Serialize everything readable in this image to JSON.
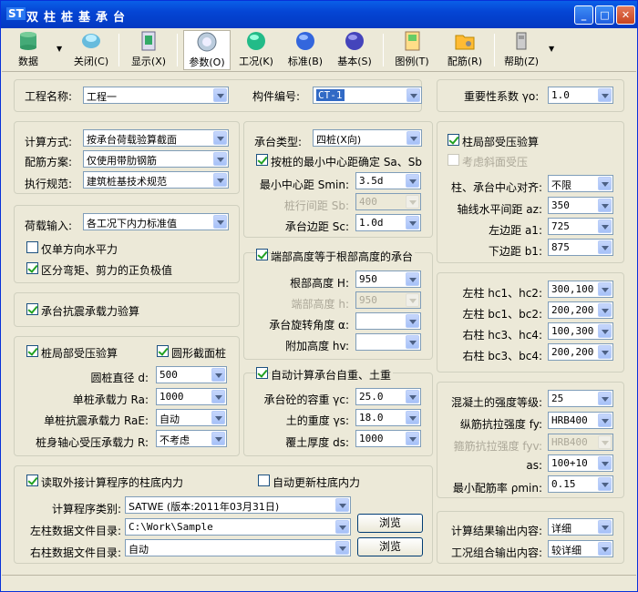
{
  "app": {
    "logo": "ST",
    "title": "双柱桩基承台"
  },
  "toolbar": [
    {
      "name": "data",
      "label": "数据",
      "icon": "database-icon",
      "color": "#3b6"
    },
    {
      "name": "close",
      "label": "关闭(C)",
      "icon": "close-doc-icon",
      "color": "#39c"
    },
    {
      "name": "show",
      "label": "显示(X)",
      "icon": "display-icon",
      "color": "#396"
    },
    {
      "name": "params",
      "label": "参数(O)",
      "icon": "params-icon",
      "color": "#8ad"
    },
    {
      "name": "condition",
      "label": "工况(K)",
      "icon": "green-ball-icon",
      "color": "#3c9"
    },
    {
      "name": "standard",
      "label": "标准(B)",
      "icon": "blue-ball-icon",
      "color": "#36d"
    },
    {
      "name": "basic",
      "label": "基本(S)",
      "icon": "purple-ball-icon",
      "color": "#55c"
    },
    {
      "name": "drawing",
      "label": "图例(T)",
      "icon": "drawing-icon",
      "color": "#c93"
    },
    {
      "name": "rebar",
      "label": "配筋(R)",
      "icon": "rebar-folder-icon",
      "color": "#e90"
    },
    {
      "name": "help",
      "label": "帮助(Z)",
      "icon": "help-icon",
      "color": "#888"
    }
  ],
  "top": {
    "proj_label": "工程名称:",
    "proj_value": "工程一",
    "comp_label": "构件编号:",
    "comp_value": "CT-1",
    "imp_label": "重要性系数 γo:",
    "imp_value": "1.0"
  },
  "calc": {
    "method_label": "计算方式:",
    "method_value": "按承台荷载验算截面",
    "rebar_label": "配筋方案:",
    "rebar_value": "仅使用带肋钢筋",
    "code_label": "执行规范:",
    "code_value": "建筑桩基技术规范"
  },
  "load": {
    "input_label": "荷载输入:",
    "input_value": "各工况下内力标准值",
    "single_dir": "仅单方向水平力",
    "distinguish": "区分弯矩、剪力的正负极值"
  },
  "seismic": {
    "label": "承台抗震承载力验算"
  },
  "pile": {
    "local_label": "桩局部受压验算",
    "circle_label": "圆形截面桩",
    "dia_label": "圆桩直径 d:",
    "dia_value": "500",
    "ra_label": "单桩承载力 Ra:",
    "ra_value": "1000",
    "rae_label": "单桩抗震承载力 RaE:",
    "rae_value": "自动",
    "r_label": "桩身轴心受压承载力 R:",
    "r_value": "不考虑"
  },
  "cap": {
    "type_label": "承台类型:",
    "type_value": "四桩(X向)",
    "minspace_label": "按桩的最小中心距确定 Sa、Sb",
    "smin_label": "最小中心距 Smin:",
    "smin_value": "3.5d",
    "sb_label": "桩行间距 Sb:",
    "sb_value": "400",
    "sc_label": "承台边距 Sc:",
    "sc_value": "1.0d"
  },
  "height": {
    "title": "端部高度等于根部高度的承台",
    "H_label": "根部高度 H:",
    "H_value": "950",
    "h_label": "端部高度 h:",
    "h_value": "950",
    "angle_label": "承台旋转角度 α:",
    "angle_value": "",
    "hv_label": "附加高度 hv:",
    "hv_value": ""
  },
  "weight": {
    "title": "自动计算承台自重、土重",
    "yc_label": "承台砼的容重 γc:",
    "yc_value": "25.0",
    "ys_label": "土的重度 γs:",
    "ys_value": "18.0",
    "ds_label": "覆土厚度 ds:",
    "ds_value": "1000"
  },
  "external": {
    "read_label": "读取外接计算程序的柱底内力",
    "auto_label": "自动更新柱底内力",
    "prog_label": "计算程序类别:",
    "prog_value": "SATWE (版本:2011年03月31日)",
    "left_label": "左柱数据文件目录:",
    "left_value": "C:\\Work\\Sample",
    "right_label": "右柱数据文件目录:",
    "right_value": "自动",
    "browse": "浏览"
  },
  "column": {
    "local_label": "柱局部受压验算",
    "slope_label": "考虑斜面受压",
    "align_label": "柱、承台中心对齐:",
    "align_value": "不限",
    "az_label": "轴线水平间距 az:",
    "az_value": "350",
    "a1_label": "左边距 a1:",
    "a1_value": "725",
    "b1_label": "下边距 b1:",
    "b1_value": "875"
  },
  "colsize": {
    "hc12_label": "左柱 hc1、hc2:",
    "hc12_value": "300,100",
    "bc12_label": "左柱 bc1、bc2:",
    "bc12_value": "200,200",
    "hc34_label": "右柱 hc3、hc4:",
    "hc34_value": "100,300",
    "bc34_label": "右柱 bc3、bc4:",
    "bc34_value": "200,200"
  },
  "material": {
    "conc_label": "混凝土的强度等级:",
    "conc_value": "25",
    "fy_label": "纵筋抗拉强度 fy:",
    "fy_value": "HRB400",
    "fyv_label": "箍筋抗拉强度 fyv:",
    "fyv_value": "HRB400",
    "as_label": "as:",
    "as_value": "100+10",
    "pmin_label": "最小配筋率 ρmin:",
    "pmin_value": "0.15"
  },
  "output": {
    "result_label": "计算结果输出内容:",
    "result_value": "详细",
    "combo_label": "工况组合输出内容:",
    "combo_value": "较详细"
  }
}
